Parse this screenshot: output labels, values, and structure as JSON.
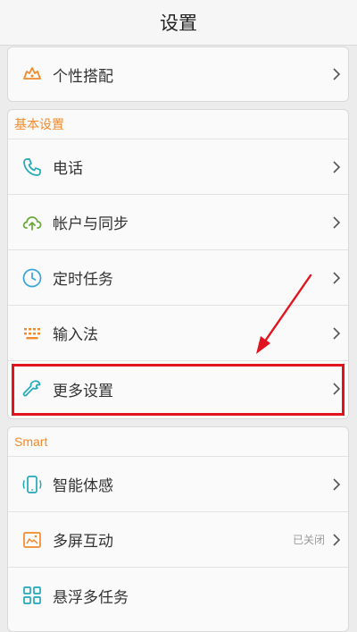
{
  "header": {
    "title": "设置"
  },
  "card1": {
    "rows": [
      {
        "label": "个性搭配",
        "icon": "theme-icon"
      }
    ]
  },
  "basic": {
    "section_label": "基本设置",
    "rows": [
      {
        "label": "电话",
        "icon": "phone-icon"
      },
      {
        "label": "帐户与同步",
        "icon": "cloud-sync-icon"
      },
      {
        "label": "定时任务",
        "icon": "clock-icon"
      },
      {
        "label": "输入法",
        "icon": "keyboard-icon"
      },
      {
        "label": "更多设置",
        "icon": "wrench-icon"
      }
    ]
  },
  "smart": {
    "section_label": "Smart",
    "rows": [
      {
        "label": "智能体感",
        "icon": "motion-icon"
      },
      {
        "label": "多屏互动",
        "icon": "multiscreen-icon",
        "status": "已关闭"
      },
      {
        "label": "悬浮多任务",
        "icon": "floating-task-icon"
      }
    ]
  },
  "colors": {
    "accent": "#f08a2a",
    "icon_teal": "#22a8b8",
    "icon_green": "#6aa83a",
    "annotation_red": "#e0141e"
  }
}
